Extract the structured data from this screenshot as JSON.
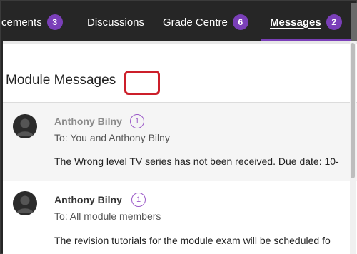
{
  "nav": {
    "tabs": [
      {
        "label": "cements",
        "badge": "3"
      },
      {
        "label": "Discussions",
        "badge": ""
      },
      {
        "label": "Grade Centre",
        "badge": "6"
      },
      {
        "label": "Messages",
        "badge": "2",
        "active": true
      }
    ],
    "accent_color": "#7a3fb8"
  },
  "page": {
    "title": "Module Messages"
  },
  "messages": [
    {
      "sender": "Anthony Bilny",
      "count": "1",
      "to": "To: You and Anthony Bilny",
      "body": "The Wrong level TV series has not been received. Due date: 10-",
      "read": true,
      "highlighted": true
    },
    {
      "sender": "Anthony Bilny",
      "count": "1",
      "to": "To: All module members",
      "body": "The revision tutorials for the module exam will be scheduled fo",
      "read": false
    }
  ],
  "icons": {
    "avatar": "default-user-avatar-icon"
  }
}
